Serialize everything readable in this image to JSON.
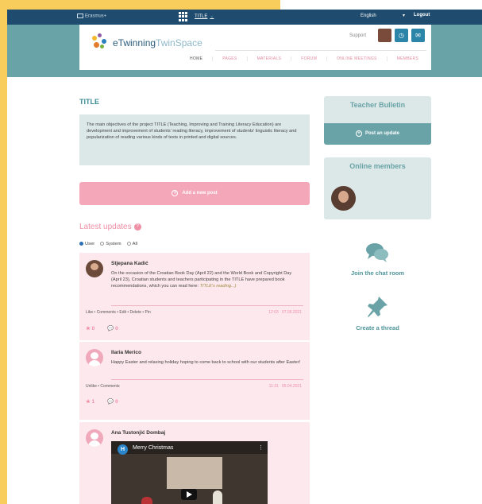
{
  "topbar": {
    "brand": "Erasmus+",
    "project_selector": "TITLE",
    "language": "English",
    "logout": "Logout"
  },
  "header": {
    "logo_part1": "eTwinning",
    "logo_part2": "TwinSpace",
    "support": "Support",
    "nav": [
      "HOME",
      "PAGES",
      "MATERIALS",
      "FORUM",
      "ONLINE MEETINGS",
      "MEMBERS"
    ]
  },
  "main": {
    "title": "TITLE",
    "description": "The main objectives of the project TITLE (Teaching, Improving and Training Literacy Education) are development and improvement of students' reading literacy, improvement of students' linguistic literacy and popularization of reading various kinds of texts in printed and digital sources.",
    "add_post": "Add a new post",
    "latest_updates": "Latest updates",
    "filters": [
      "User",
      "System",
      "All"
    ],
    "selected_filter": "User"
  },
  "posts": [
    {
      "author": "Stjepana Kadić",
      "text": "On the occasion of the Croatian Book Day (April 22) and the World Book and Copyright Day (April 23), Croatian students and teachers participating in the TITLE have prepared book recommendations, which you can read here:",
      "link": "TITLE's reading...)",
      "actions": "Like • Comments • Edit • Delete • Pin",
      "time": "12:03",
      "date": "07.06.2021",
      "likes": "0",
      "comments": "0"
    },
    {
      "author": "Ilaria Merico",
      "text": "Happy Easter and relaxing holiday hoping to come back to school with our students after Easter!",
      "actions": "Unlike • Comments",
      "time": "11:31",
      "date": "05.04.2021",
      "likes": "1",
      "comments": "0"
    },
    {
      "author": "Ana Tustonjić Dombaj",
      "video_badge": "H",
      "video_title": "Merry Christmas"
    }
  ],
  "sidebar": {
    "bulletin_title": "Teacher Bulletin",
    "post_update": "Post an update",
    "online_title": "Online members",
    "chat": "Join the chat room",
    "thread": "Create a thread"
  },
  "colors": {
    "teal": "#6aa3a7",
    "navy": "#1f4c6e",
    "pink": "#f3a7b9",
    "yellow": "#f9cd5b"
  }
}
